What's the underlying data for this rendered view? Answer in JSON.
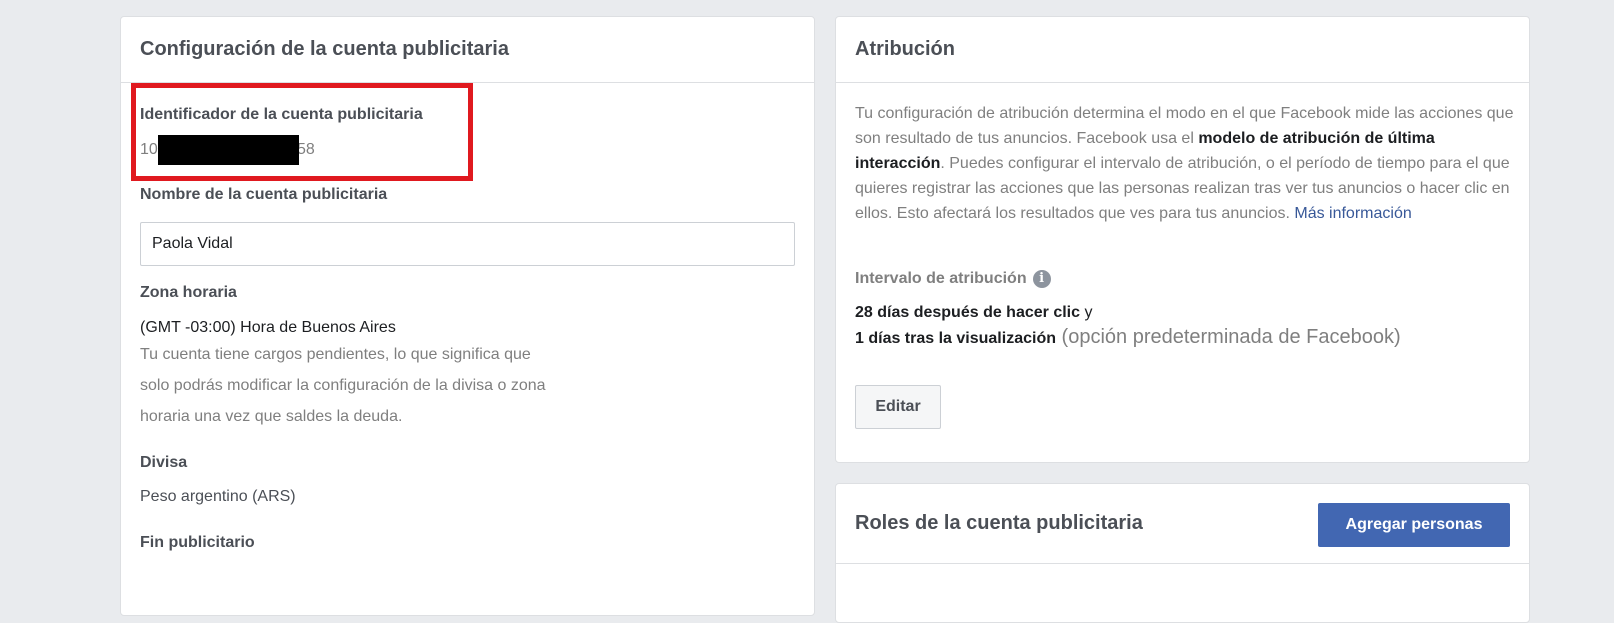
{
  "account": {
    "title": "Configuración de la cuenta publicitaria",
    "id_label": "Identificador de la cuenta publicitaria",
    "id_prefix": "10",
    "id_suffix": "58",
    "name_label": "Nombre de la cuenta publicitaria",
    "name_value": "Paola Vidal",
    "timezone_label": "Zona horaria",
    "timezone_value": "(GMT -03:00) Hora de Buenos Aires",
    "timezone_note_1": "Tu cuenta tiene cargos pendientes, lo que significa que",
    "timezone_note_2": "solo podrás modificar la configuración de la divisa o zona",
    "timezone_note_3": "horaria una vez que saldes la deuda.",
    "currency_label": "Divisa",
    "currency_value": "Peso argentino (ARS)",
    "purpose_label": "Fin publicitario"
  },
  "attribution": {
    "title": "Atribución",
    "desc_1": "Tu configuración de atribución determina el modo en el que Facebook mide las acciones que son resultado de tus anuncios. Facebook usa el ",
    "desc_bold": "modelo de atribución de última interacción",
    "desc_2": ". Puedes configurar el intervalo de atribución, o el período de tiempo para el que quieres registrar las acciones que las personas realizan tras ver tus anuncios o hacer clic en ellos. Esto afectará los resultados que ves para tus anuncios. ",
    "desc_link": "Más información",
    "interval_label": "Intervalo de atribución",
    "interval_line1_bold": "28 días después de hacer clic",
    "interval_line1_rest": " y",
    "interval_line2_bold": "1 días tras la visualización",
    "interval_line2_rest": " (opción predeterminada de Facebook)",
    "edit_button": "Editar",
    "info_glyph": "i"
  },
  "roles": {
    "title": "Roles de la cuenta publicitaria",
    "add_button": "Agregar personas"
  },
  "colors": {
    "accent": "#4267b2",
    "highlight": "#e0191f",
    "link": "#385898"
  }
}
